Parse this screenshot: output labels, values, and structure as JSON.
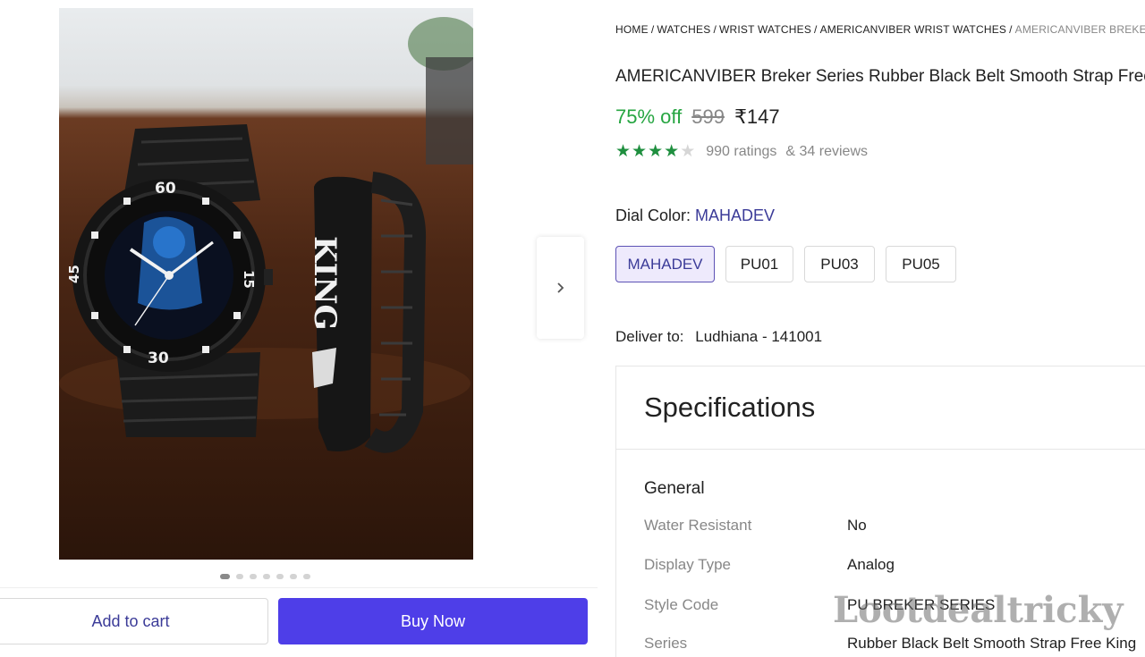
{
  "gallery": {
    "dot_count": 7,
    "active_dot": 1,
    "dial_numbers": [
      "60",
      "15",
      "30",
      "45"
    ],
    "bracelet_text": "KING"
  },
  "actions": {
    "add_to_cart": "Add to cart",
    "buy_now": "Buy Now"
  },
  "breadcrumb": [
    "HOME",
    "WATCHES",
    "WRIST WATCHES",
    "AMERICANVIBER WRIST WATCHES",
    "AMERICANVIBER BREKER SERIES"
  ],
  "product": {
    "title": "AMERICANVIBER Breker Series Rubber Black Belt Smooth Strap Free King",
    "discount": "75% off",
    "mrp": "599",
    "price": "₹147",
    "rating": 4,
    "ratings_text": "990 ratings",
    "reviews_text": "& 34 reviews",
    "rating_color": "#1f8f3f"
  },
  "dial_color": {
    "label": "Dial Color:",
    "value": "MAHADEV",
    "options": [
      "MAHADEV",
      "PU01",
      "PU03",
      "PU05"
    ],
    "selected": "MAHADEV"
  },
  "delivery": {
    "label": "Deliver to:",
    "location": "Ludhiana - 141001"
  },
  "specifications": {
    "heading": "Specifications",
    "group": "General",
    "rows": [
      {
        "key": "Water Resistant",
        "value": "No"
      },
      {
        "key": "Display Type",
        "value": "Analog"
      },
      {
        "key": "Style Code",
        "value": "PU BREKER SERIES"
      },
      {
        "key": "Series",
        "value": "Rubber Black Belt Smooth Strap Free King"
      }
    ]
  },
  "watermark": "Lootdealtricky",
  "colors": {
    "primary_button": "#4e3ee8",
    "discount_green": "#26a541",
    "accent_purple": "#3b3b98"
  }
}
